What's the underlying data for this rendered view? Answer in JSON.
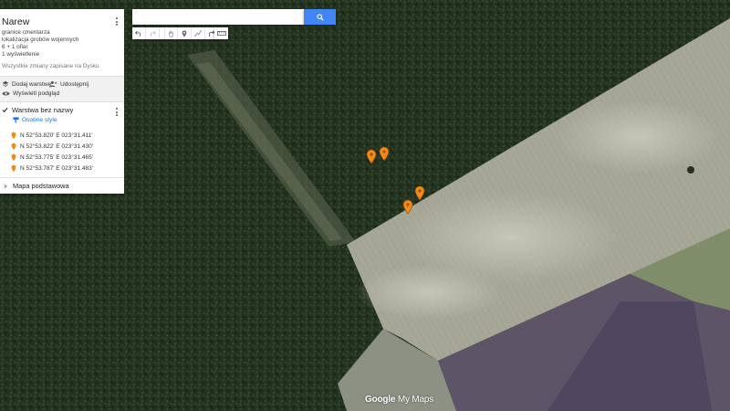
{
  "map": {
    "type": "satellite",
    "colors": {
      "forest": "#24331f",
      "field": "#a2a391",
      "field_light": "#b8b8a8",
      "field_purple": "#5c5266",
      "marker": "#f28a1a"
    },
    "logo": {
      "google": "Google",
      "suffix": "My Maps"
    }
  },
  "panel": {
    "title": "Narew",
    "description": [
      "granice cmentarza",
      "lokalizacja grobów wojennych",
      "6 + 1 ofiar",
      "1 wyświetlenie"
    ],
    "saved_status": "Wszystkie zmiany zapisane na Dysku",
    "actions": {
      "add_layer": "Dodaj warstwę",
      "share": "Udostępnij",
      "preview": "Wyświetl podgląd"
    },
    "layer": {
      "name": "Warstwa bez nazwy",
      "checked": true,
      "style_link": "Osobne style",
      "places": [
        "N 52°53.820' E 023°31.411'",
        "N 52°53.822' E 023°31.430'",
        "N 52°53.775' E 023°31.465'",
        "N 52°53.787' E 023°31.483'"
      ]
    },
    "base_map": "Mapa podstawowa"
  },
  "search": {
    "placeholder": "",
    "value": ""
  },
  "toolbar": {
    "icons": [
      "undo-icon",
      "redo-icon",
      "hand-icon",
      "marker-icon",
      "draw-line-icon",
      "directions-icon",
      "ruler-icon"
    ]
  }
}
